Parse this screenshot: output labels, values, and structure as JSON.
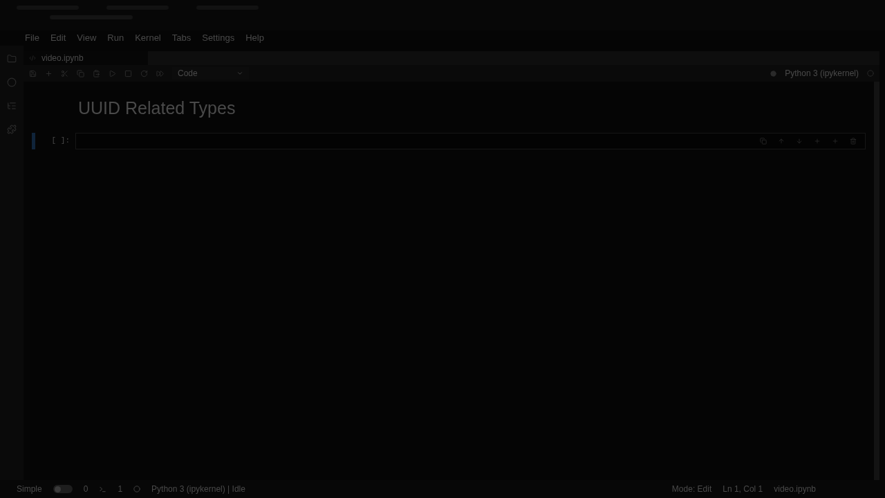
{
  "menu": [
    "File",
    "Edit",
    "View",
    "Run",
    "Kernel",
    "Tabs",
    "Settings",
    "Help"
  ],
  "tabs": [
    {
      "label": "video.ipynb",
      "selected": true
    }
  ],
  "toolbar": {
    "cell_type": "Code",
    "kernel": "Python 3 (ipykernel)"
  },
  "cells": [
    {
      "kind": "markdown",
      "text": "UUID Related Types",
      "selected": false
    },
    {
      "kind": "code",
      "prompt": "[ ]:",
      "selected": true
    }
  ],
  "status_bar": {
    "simple": {
      "label": "Simple",
      "on": false
    },
    "counts": [
      "0",
      "1"
    ],
    "kernel": "Python 3 (ipykernel) | Idle",
    "mode": "Mode: Edit",
    "position": "Ln 1, Col 1",
    "file": "video.ipynb"
  }
}
